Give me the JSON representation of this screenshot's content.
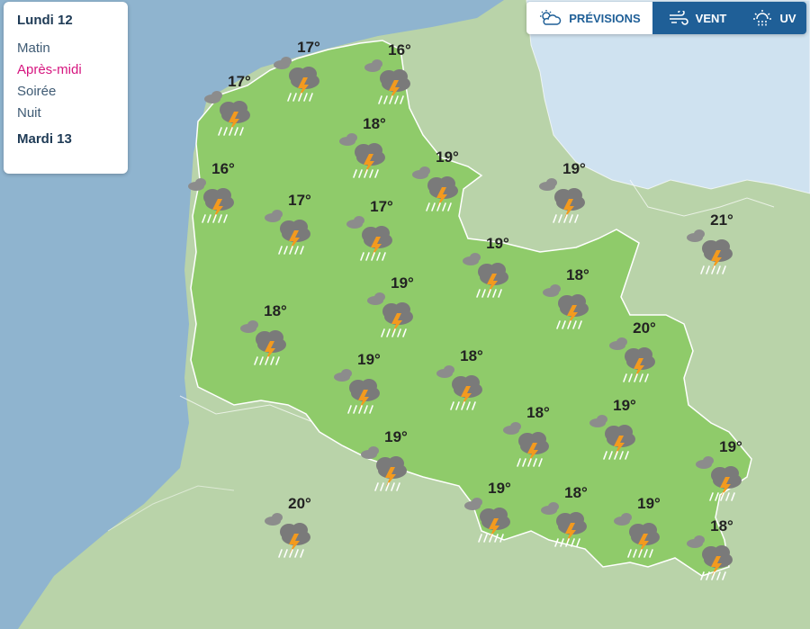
{
  "panel": {
    "day1": "Lundi 12",
    "periods": [
      "Matin",
      "Après-midi",
      "Soirée",
      "Nuit"
    ],
    "active_period": "Après-midi",
    "day2": "Mardi 13"
  },
  "tabs": {
    "forecast": "PRÉVISIONS",
    "wind": "VENT",
    "uv": "UV",
    "icons": [
      "partly-cloudy-icon",
      "wind-icon",
      "uv-sun-icon"
    ]
  },
  "weather_icon": "thunderstorm-rain-icon",
  "temperatures": [
    {
      "city": "1",
      "temp": "17°"
    },
    {
      "city": "2",
      "temp": "16°"
    },
    {
      "city": "3",
      "temp": "17°"
    },
    {
      "city": "4",
      "temp": "18°"
    },
    {
      "city": "5",
      "temp": "16°"
    },
    {
      "city": "6",
      "temp": "19°"
    },
    {
      "city": "7",
      "temp": "19°"
    },
    {
      "city": "8",
      "temp": "17°"
    },
    {
      "city": "9",
      "temp": "17°"
    },
    {
      "city": "10",
      "temp": "21°"
    },
    {
      "city": "11",
      "temp": "19°"
    },
    {
      "city": "12",
      "temp": "18°"
    },
    {
      "city": "13",
      "temp": "19°"
    },
    {
      "city": "14",
      "temp": "18°"
    },
    {
      "city": "15",
      "temp": "20°"
    },
    {
      "city": "16",
      "temp": "19°"
    },
    {
      "city": "17",
      "temp": "18°"
    },
    {
      "city": "18",
      "temp": "18°"
    },
    {
      "city": "19",
      "temp": "19°"
    },
    {
      "city": "20",
      "temp": "19°"
    },
    {
      "city": "21",
      "temp": "19°"
    },
    {
      "city": "22",
      "temp": "20°"
    },
    {
      "city": "23",
      "temp": "19°"
    },
    {
      "city": "24",
      "temp": "18°"
    },
    {
      "city": "25",
      "temp": "19°"
    },
    {
      "city": "26",
      "temp": "18°"
    }
  ],
  "colors": {
    "sea": "#8fb4cf",
    "land": "#b9d3a9",
    "region": "#8fcb6a",
    "region_border": "#ffffff",
    "accent": "#d6157f",
    "tab_blue": "#1f5f97"
  }
}
